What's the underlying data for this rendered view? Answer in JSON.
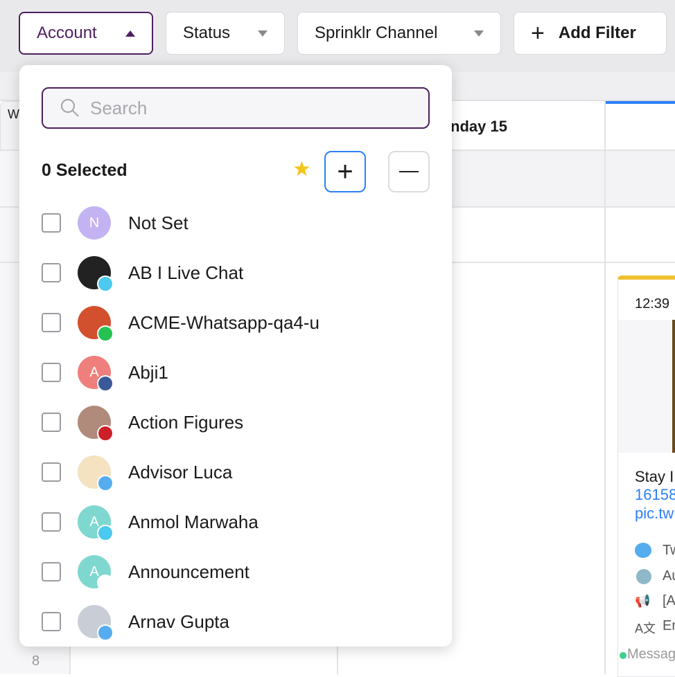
{
  "filters": {
    "account": "Account",
    "status": "Status",
    "channel": "Sprinklr Channel",
    "add": "Add Filter"
  },
  "calendar": {
    "day_header": "nday 15",
    "left_header": "W",
    "hour_label": "8",
    "card": {
      "time": "12:39",
      "text": "Stay I",
      "link1": "16158",
      "link2": "pic.tw",
      "rows": [
        "Tw",
        "Au",
        "[A",
        "En"
      ],
      "status": "Messag"
    }
  },
  "dropdown": {
    "search_placeholder": "Search",
    "selected": "0 Selected",
    "items": [
      {
        "label": "Not Set",
        "initial": "N",
        "color": "#c3b3f2",
        "badge": ""
      },
      {
        "label": "AB I Live Chat",
        "initial": "",
        "color": "#222222",
        "badge": "chat",
        "badge_color": "#4cc9f0"
      },
      {
        "label": "ACME-Whatsapp-qa4-u",
        "initial": "",
        "color": "#d2502e",
        "badge": "whatsapp-business",
        "badge_color": "#25c251"
      },
      {
        "label": "Abji1",
        "initial": "A",
        "color": "#ef7f7c",
        "badge": "facebook",
        "badge_color": "#3b5998"
      },
      {
        "label": "Action Figures",
        "initial": "",
        "color": "#b08a7a",
        "badge": "pinterest",
        "badge_color": "#cb2027"
      },
      {
        "label": "Advisor Luca",
        "initial": "",
        "color": "#f4e2c0",
        "badge": "twitter",
        "badge_color": "#55acee"
      },
      {
        "label": "Anmol Marwaha",
        "initial": "A",
        "color": "#7fd8cf",
        "badge": "chat",
        "badge_color": "#4cc9f0"
      },
      {
        "label": "Announcement",
        "initial": "A",
        "color": "#7fd8cf",
        "badge": "announcement",
        "badge_color": "#ffffff"
      },
      {
        "label": "Arnav Gupta",
        "initial": "",
        "color": "#c9ced6",
        "badge": "twitter",
        "badge_color": "#55acee"
      }
    ]
  },
  "colors": {
    "accent": "#4e1f5e",
    "today": "#2d7ff9",
    "card_bar": "#f0c030"
  }
}
